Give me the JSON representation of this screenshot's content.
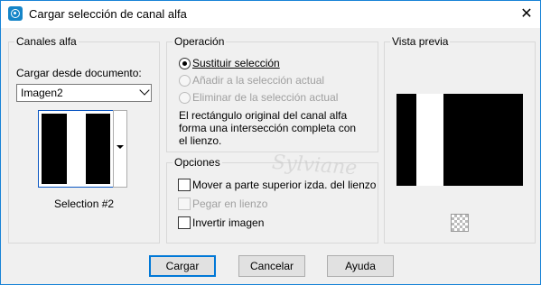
{
  "window": {
    "title": "Cargar selección de canal alfa",
    "close_glyph": "✕"
  },
  "alpha_channels": {
    "legend": "Canales alfa",
    "load_from_label": "Cargar desde documento:",
    "document_selected": "Imagen2",
    "selection_caption": "Selection #2"
  },
  "operation": {
    "legend": "Operación",
    "options": [
      {
        "label": "Sustituir selección",
        "checked": true,
        "enabled": true
      },
      {
        "label": "Añadir a la selección actual",
        "checked": false,
        "enabled": false
      },
      {
        "label": "Eliminar de la selección actual",
        "checked": false,
        "enabled": false
      }
    ],
    "note_line1": "El rectángulo original del canal alfa",
    "note_line2": "forma una intersección completa con",
    "note_line3": "el lienzo."
  },
  "options": {
    "legend": "Opciones",
    "items": [
      {
        "label": "Mover a parte superior izda. del lienzo",
        "checked": false,
        "enabled": true
      },
      {
        "label": "Pegar en lienzo",
        "checked": false,
        "enabled": false
      },
      {
        "label": "Invertir imagen",
        "checked": false,
        "enabled": true
      }
    ]
  },
  "preview": {
    "legend": "Vista previa",
    "zoom_icon": "checkerboard-icon"
  },
  "buttons": {
    "load": "Cargar",
    "cancel": "Cancelar",
    "help": "Ayuda"
  },
  "watermark": {
    "text": "Sylviane"
  },
  "colors": {
    "accent": "#0078d7",
    "title_icon": "#1585c8"
  }
}
